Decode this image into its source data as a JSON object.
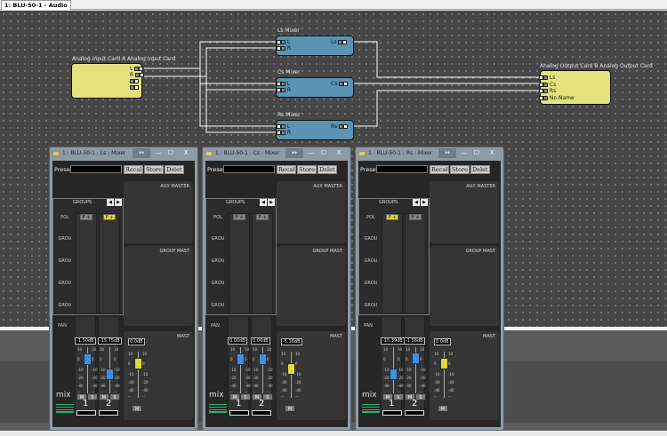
{
  "tab": {
    "title": "1: BLU-50-1 - Audio"
  },
  "canvas": {
    "input_card": {
      "label": "Analog Input Card A  Analog Input Card",
      "ports": [
        "L",
        "R",
        "",
        ""
      ]
    },
    "output_card": {
      "label": "Analog Output Card B  Analog Output Card",
      "ports": [
        "Ls",
        "Cs",
        "Rs",
        "No Name"
      ]
    },
    "mixers": [
      {
        "label": "Ls  Mixer",
        "inputs": [
          "L",
          "R"
        ],
        "output": "Ls"
      },
      {
        "label": "Cs  Mixer",
        "inputs": [
          "L",
          "R"
        ],
        "output": "Cs"
      },
      {
        "label": "Rs  Mixer",
        "inputs": [
          "L",
          "R"
        ],
        "output": "Rs"
      }
    ]
  },
  "colors": {
    "input_card": "#e4e27a",
    "mixer": "#5b93b5",
    "channel_fader": "#3d8fe0",
    "master_fader": "#e0dc30"
  },
  "common": {
    "preset": "Prese",
    "recall": "Recal",
    "store": "Store",
    "delete": "Delet",
    "aux_master": "AUX MASTER",
    "group_master": "GROUP MAST",
    "master": "MAST",
    "groups": "GROUPS",
    "pol": "POL",
    "grou": "GROU",
    "pan": "PAN",
    "mix": "mix",
    "mute": "M",
    "solo": "S",
    "ch1": "1",
    "ch2": "2",
    "pol_btn": "P +",
    "left": "◀",
    "right": "▶",
    "scale": [
      "10",
      "0",
      "-10",
      "-20",
      "-40",
      "--"
    ],
    "resize": "↔",
    "minimize": "—",
    "maximize": "☐",
    "close": "X"
  },
  "windows": [
    {
      "title": "1 : BLU-50-1 : Ls : Mixer",
      "ch1_db": "-1.50dB",
      "ch2_db": "-15.75dB",
      "master_db": "0.0dB",
      "ch1_val": 0,
      "ch2_val": -15,
      "master_val": 0,
      "pol_active": [
        false,
        true
      ]
    },
    {
      "title": "1 : BLU-50-1 : Cs : Mixer",
      "ch1_db": "0.00dB",
      "ch2_db": "0.00dB",
      "master_db": "-5.16dB",
      "ch1_val": 0,
      "ch2_val": 0,
      "master_val": -5.16,
      "pol_active": [
        false,
        false
      ]
    },
    {
      "title": "1 : BLU-50-1 : Rs : Mixer",
      "ch1_db": "-15.39dB",
      "ch2_db": "-1.58dB",
      "master_db": "0.0dB",
      "ch1_val": -15.39,
      "ch2_val": 1,
      "master_val": 0,
      "pol_active": [
        true,
        false
      ]
    }
  ]
}
